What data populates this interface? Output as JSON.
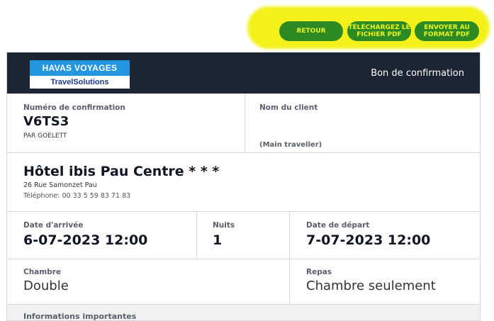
{
  "actions": {
    "retour": "RETOUR",
    "telecharger": "TÉLÉCHARGEZ LE\nFICHIER PDF",
    "envoyer": "ENVOYER AU\nFORMAT PDF"
  },
  "header": {
    "logo_top": "HAVAS VOYAGES",
    "logo_bottom": "TravelSolutions",
    "title": "Bon de confirmation"
  },
  "confirmation": {
    "label": "Numéro de confirmation",
    "number": "V6TS3",
    "by": "PAR GOELETT"
  },
  "client": {
    "label": "Nom du client",
    "note": "(Main traveller)"
  },
  "hotel": {
    "name": "Hôtel ibis Pau Centre * * *",
    "address": "26 Rue Samonzet Pau",
    "phone": "Téléphone: 00 33 5 59 83 71 83"
  },
  "dates": {
    "arrival_label": "Date d'arrivée",
    "arrival": "6-07-2023 12:00",
    "nights_label": "Nuits",
    "nights": "1",
    "departure_label": "Date de départ",
    "departure": "7-07-2023 12:00"
  },
  "room": {
    "room_label": "Chambre",
    "room": "Double",
    "meal_label": "Repas",
    "meal": "Chambre seulement"
  },
  "info": {
    "label": "Informations importantes"
  }
}
